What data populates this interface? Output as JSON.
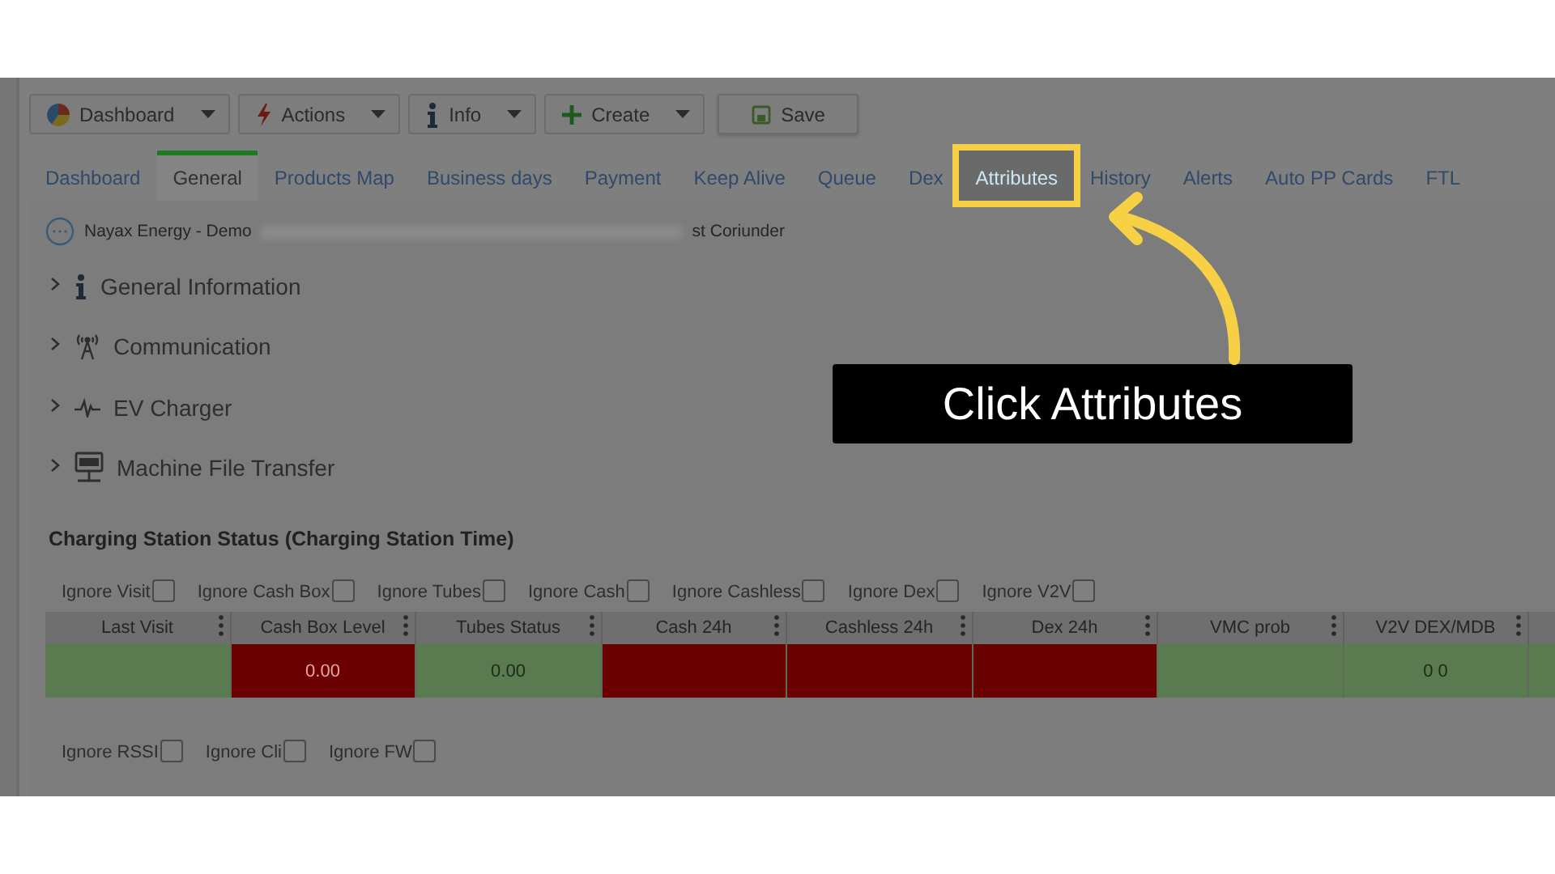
{
  "toolbar": {
    "buttons": [
      {
        "label": "Dashboard",
        "kind": "pie",
        "dropdown": true
      },
      {
        "label": "Actions",
        "kind": "bolt",
        "dropdown": true
      },
      {
        "label": "Info",
        "kind": "info",
        "dropdown": true
      },
      {
        "label": "Create",
        "kind": "plus",
        "dropdown": true
      },
      {
        "label": "Save",
        "kind": "disk",
        "dropdown": false
      }
    ]
  },
  "tabs": [
    {
      "label": "Dashboard",
      "selected": false,
      "highlighted": false
    },
    {
      "label": "General",
      "selected": true,
      "highlighted": false
    },
    {
      "label": "Products Map",
      "selected": false,
      "highlighted": false
    },
    {
      "label": "Business days",
      "selected": false,
      "highlighted": false
    },
    {
      "label": "Payment",
      "selected": false,
      "highlighted": false
    },
    {
      "label": "Keep Alive",
      "selected": false,
      "highlighted": false
    },
    {
      "label": "Queue",
      "selected": false,
      "highlighted": false
    },
    {
      "label": "Dex",
      "selected": false,
      "highlighted": false
    },
    {
      "label": "Attributes",
      "selected": false,
      "highlighted": true
    },
    {
      "label": "History",
      "selected": false,
      "highlighted": false
    },
    {
      "label": "Alerts",
      "selected": false,
      "highlighted": false
    },
    {
      "label": "Auto PP Cards",
      "selected": false,
      "highlighted": false
    },
    {
      "label": "FTL",
      "selected": false,
      "highlighted": false
    }
  ],
  "breadcrumb": {
    "name": "Nayax Energy - Demo",
    "tail": "st Coriunder"
  },
  "sections": [
    {
      "label": "General Information",
      "kind": "info",
      "expanded": false
    },
    {
      "label": "Communication",
      "kind": "antenna",
      "expanded": false
    },
    {
      "label": "EV Charger",
      "kind": "pulse",
      "expanded": false
    },
    {
      "label": "Machine File Transfer",
      "kind": "ftp",
      "expanded": false
    }
  ],
  "status": {
    "title": "Charging Station Status (Charging Station Time)",
    "filters": [
      {
        "label": "Ignore Visit",
        "checked": false
      },
      {
        "label": "Ignore Cash Box",
        "checked": false
      },
      {
        "label": "Ignore Tubes",
        "checked": false
      },
      {
        "label": "Ignore Cash",
        "checked": false
      },
      {
        "label": "Ignore Cashless",
        "checked": false
      },
      {
        "label": "Ignore Dex",
        "checked": false
      },
      {
        "label": "Ignore V2V",
        "checked": false
      }
    ],
    "columns": [
      "Last Visit",
      "Cash Box Level",
      "Tubes Status",
      "Cash 24h",
      "Cashless 24h",
      "Dex 24h",
      "VMC prob",
      "V2V DEX/MDB"
    ],
    "cells": [
      {
        "color": "#5a7a50"
      },
      {
        "value": "0.00",
        "color": "#6a0000"
      },
      {
        "value": "0.00",
        "color": "#5a7a50"
      },
      {
        "color": "#6a0000"
      },
      {
        "color": "#6a0000"
      },
      {
        "color": "#6a0000"
      },
      {
        "color": "#5a7a50"
      },
      {
        "value": "0 0",
        "color": "#5a7a50"
      },
      {
        "color": "#5a7a50"
      }
    ],
    "filters_2": [
      {
        "label": "Ignore RSSI",
        "checked": false
      },
      {
        "label": "Ignore Cli",
        "checked": false
      },
      {
        "label": "Ignore FW",
        "checked": false
      }
    ]
  },
  "callout": {
    "text": "Click Attributes"
  }
}
